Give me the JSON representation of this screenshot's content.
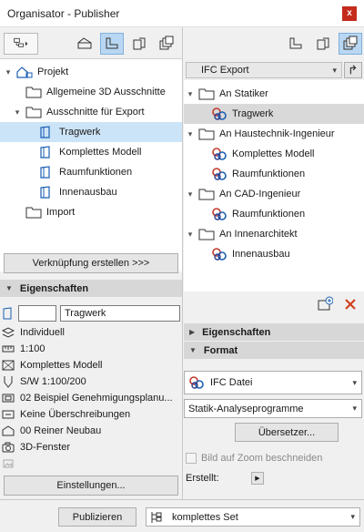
{
  "window": {
    "title": "Organisator - Publisher",
    "close_label": "x"
  },
  "left": {
    "tree": [
      {
        "label": "Projekt",
        "icon": "project-icon"
      },
      {
        "label": "Allgemeine 3D Ausschnitte",
        "icon": "folder-icon"
      },
      {
        "label": "Ausschnitte für Export",
        "icon": "folder-icon"
      },
      {
        "label": "Tragwerk",
        "icon": "view-3d-icon"
      },
      {
        "label": "Komplettes Modell",
        "icon": "view-3d-icon"
      },
      {
        "label": "Raumfunktionen",
        "icon": "view-3d-icon"
      },
      {
        "label": "Innenausbau",
        "icon": "view-3d-icon"
      },
      {
        "label": "Import",
        "icon": "folder-icon"
      }
    ],
    "link_button": "Verknüpfung erstellen >>>",
    "properties_header": "Eigenschaften",
    "id_value": "",
    "name_value": "Tragwerk",
    "properties": [
      "Individuell",
      "1:100",
      "Komplettes Modell",
      "S/W 1:100/200",
      "02 Beispiel Genehmigungsplanu...",
      "Keine Überschreibungen",
      "00 Reiner Neubau",
      "3D-Fenster"
    ],
    "settings_button": "Einstellungen..."
  },
  "right": {
    "set_name": "IFC Export",
    "tree": [
      {
        "label": "An Statiker",
        "icon": "folder-icon"
      },
      {
        "label": "Tragwerk",
        "icon": "ifc-icon"
      },
      {
        "label": "An Haustechnik-Ingenieur",
        "icon": "folder-icon"
      },
      {
        "label": "Komplettes Modell",
        "icon": "ifc-icon"
      },
      {
        "label": "Raumfunktionen",
        "icon": "ifc-icon"
      },
      {
        "label": "An CAD-Ingenieur",
        "icon": "folder-icon"
      },
      {
        "label": "Raumfunktionen",
        "icon": "ifc-icon"
      },
      {
        "label": "An Innenarchitekt",
        "icon": "folder-icon"
      },
      {
        "label": "Innenausbau",
        "icon": "ifc-icon"
      }
    ],
    "properties_header": "Eigenschaften",
    "format_header": "Format",
    "format_value": "IFC Datei",
    "translator_value": "Statik-Analyseprogramme",
    "translator_button": "Übersetzer...",
    "zoom_checkbox": "Bild auf Zoom beschneiden",
    "created_label": "Erstellt:"
  },
  "bottom": {
    "publish_button": "Publizieren",
    "set_value": "komplettes Set"
  },
  "colors": {
    "accent": "#1a5fb4",
    "ifc_red": "#c0392b",
    "selected": "#cce4f7"
  }
}
